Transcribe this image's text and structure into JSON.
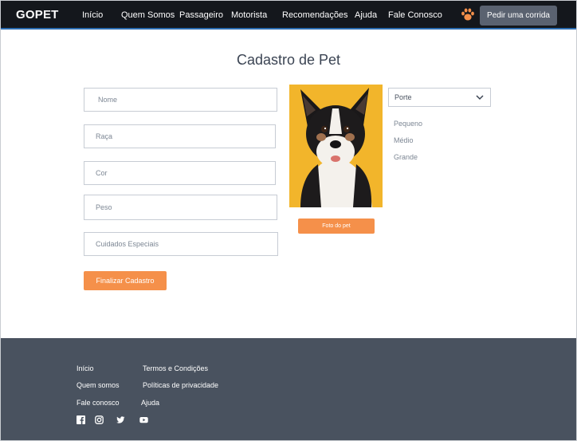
{
  "navbar": {
    "brand": "GOPET",
    "links": [
      "Início",
      "Quem Somos",
      "Passageiro",
      "Motorista",
      "Recomendações",
      "Ajuda",
      "Fale Conosco"
    ],
    "paw_icon": "paw-icon",
    "cta": "Pedir uma corrida"
  },
  "form": {
    "title": "Cadastro de Pet",
    "fields": {
      "name": "Nome",
      "breed": "Raça",
      "color": "Cor",
      "weight": "Peso",
      "special_care": "Cuidados Especiais"
    },
    "submit": "Finalizar Cadastro",
    "photo_button": "Foto do pet",
    "size_select": {
      "placeholder": "Porte",
      "options": [
        "Pequeno",
        "Médio",
        "Grande"
      ]
    }
  },
  "footer": {
    "col1": [
      "Início",
      "Quem somos",
      "Fale conosco"
    ],
    "col2": [
      "Termos e Condições",
      "Políticas de privacidade",
      "Ajuda"
    ],
    "social": [
      "facebook-icon",
      "instagram-icon",
      "twitter-icon",
      "youtube-icon"
    ]
  },
  "colors": {
    "navbar": "#14171c",
    "accent": "#f5904a",
    "footer": "#49525f",
    "cta": "#5a6270"
  }
}
